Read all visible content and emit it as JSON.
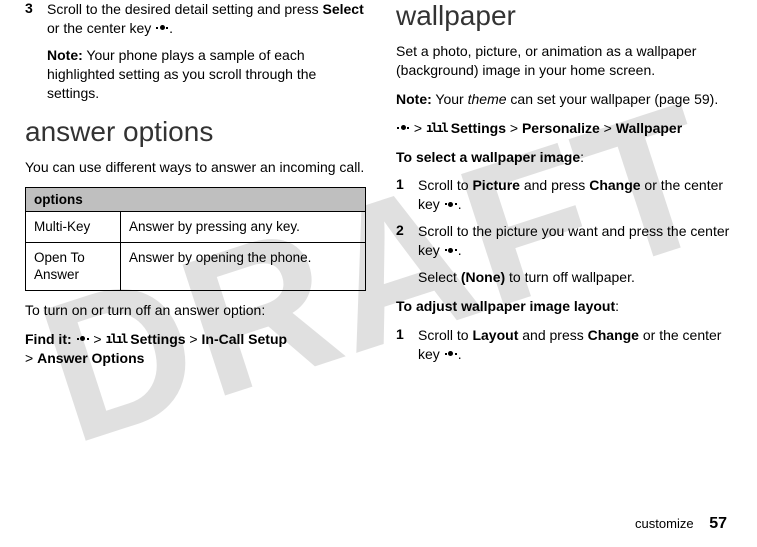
{
  "watermark": "DRAFT",
  "left": {
    "step3_num": "3",
    "step3_text_a": "Scroll to the desired detail setting and press ",
    "step3_select": "Select",
    "step3_text_b": " or the center key ",
    "step3_text_c": ".",
    "note_label": "Note:",
    "note_text": " Your phone plays a sample of each highlighted setting as you scroll through the settings.",
    "h_answer": "answer options",
    "answer_intro": "You can use different ways to answer an incoming call.",
    "options_header": "options",
    "row1_k": "Multi-Key",
    "row1_v": "Answer by pressing any key.",
    "row2_k": "Open To Answer",
    "row2_v": "Answer by opening the phone.",
    "toggle_text": "To turn on or turn off an answer option:",
    "findit": "Find it:",
    "sep": " > ",
    "settings_label": " Settings",
    "incall": "In-Call Setup",
    "answer_options": "Answer Options"
  },
  "right": {
    "h_wallpaper": "wallpaper",
    "wp_intro": "Set a photo, picture, or animation as a wallpaper (background) image in your home screen.",
    "note_label": "Note:",
    "note_a": " Your ",
    "note_theme": "theme",
    "note_b": " can set your wallpaper (page 59).",
    "path_settings": " Settings",
    "path_personalize": "Personalize",
    "path_wallpaper": "Wallpaper",
    "select_head": "To select a wallpaper image",
    "colon": ":",
    "s1_num": "1",
    "s1_a": "Scroll to ",
    "s1_picture": "Picture",
    "s1_b": " and press ",
    "s1_change": "Change",
    "s1_c": " or the center key ",
    "s1_d": ".",
    "s2_num": "2",
    "s2_a": "Scroll to the picture you want and press the center key ",
    "s2_b": ".",
    "s2_sel": "Select ",
    "s2_none": "(None)",
    "s2_off": " to turn off wallpaper.",
    "adjust_head": "To adjust wallpaper image layout",
    "a1_num": "1",
    "a1_a": "Scroll to ",
    "a1_layout": "Layout",
    "a1_b": " and press ",
    "a1_change": "Change",
    "a1_c": " or the center key ",
    "a1_d": "."
  },
  "footer": {
    "section": "customize",
    "page": "57"
  },
  "icons": {
    "settings": "ılıl"
  }
}
